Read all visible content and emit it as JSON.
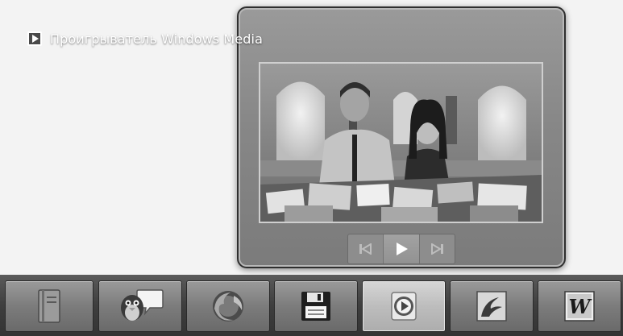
{
  "preview": {
    "title": "Проигрыватель Windows Media",
    "app_icon": "windows-media-player-icon",
    "controls": [
      {
        "name": "previous-track-button",
        "icon": "skip-previous-icon"
      },
      {
        "name": "play-button",
        "icon": "play-icon"
      },
      {
        "name": "next-track-button",
        "icon": "skip-next-icon"
      }
    ]
  },
  "taskbar": {
    "items": [
      {
        "name": "taskbar-notebook",
        "icon": "notebook-icon",
        "active": false
      },
      {
        "name": "taskbar-chat",
        "icon": "chat-messenger-icon",
        "active": false
      },
      {
        "name": "taskbar-firefox",
        "icon": "firefox-icon",
        "active": false
      },
      {
        "name": "taskbar-save",
        "icon": "floppy-disk-icon",
        "active": false
      },
      {
        "name": "taskbar-media-player",
        "icon": "windows-media-player-icon",
        "active": true
      },
      {
        "name": "taskbar-flash",
        "icon": "flash-icon",
        "active": false
      },
      {
        "name": "taskbar-word",
        "icon": "word-icon",
        "active": false
      }
    ]
  },
  "colors": {
    "taskbar": "#3e3e3e",
    "preview_frame": "#878787",
    "active_button": "#bdbdbd"
  }
}
